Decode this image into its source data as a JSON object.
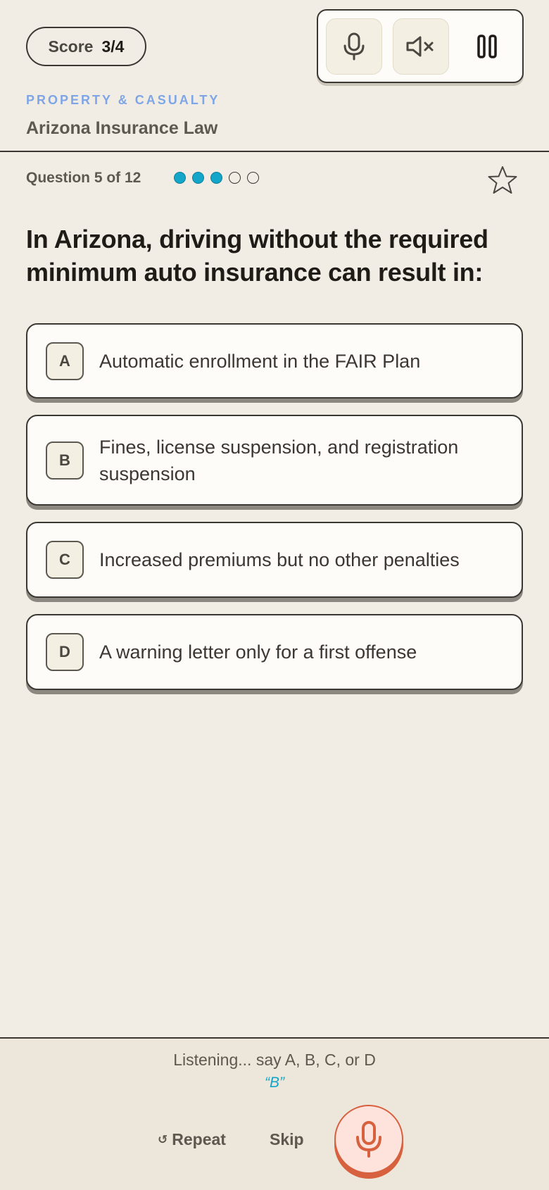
{
  "score": {
    "label": "Score",
    "value": "3/4"
  },
  "controls": {
    "mic_icon": "microphone-icon",
    "mute_icon": "speaker-muted-icon",
    "pause_icon": "pause-icon"
  },
  "topic": {
    "category": "PROPERTY & CASUALTY",
    "subject": "Arizona Insurance Law"
  },
  "progress": {
    "label": "Question 5 of 12",
    "dots": [
      "filled",
      "filled",
      "filled",
      "empty",
      "empty"
    ]
  },
  "favorite_icon": "star-outline-icon",
  "question": "In Arizona, driving without the required minimum auto insurance can result in:",
  "options": [
    {
      "letter": "A",
      "text": "Automatic enrollment in the FAIR Plan"
    },
    {
      "letter": "B",
      "text": "Fines, license suspension, and registration suspension"
    },
    {
      "letter": "C",
      "text": "Increased premiums but no other penalties"
    },
    {
      "letter": "D",
      "text": "A warning letter only for a first offense"
    }
  ],
  "voice": {
    "status": "Listening... say A, B, C, or D",
    "heard": "“B”"
  },
  "actions": {
    "repeat_icon": "↺",
    "repeat": "Repeat",
    "skip": "Skip",
    "mic_icon": "microphone-icon"
  },
  "colors": {
    "background": "#f1ede5",
    "accent_cyan": "#13a6c9",
    "category_blue": "#7ea6e6",
    "mic_red": "#d7613f"
  }
}
